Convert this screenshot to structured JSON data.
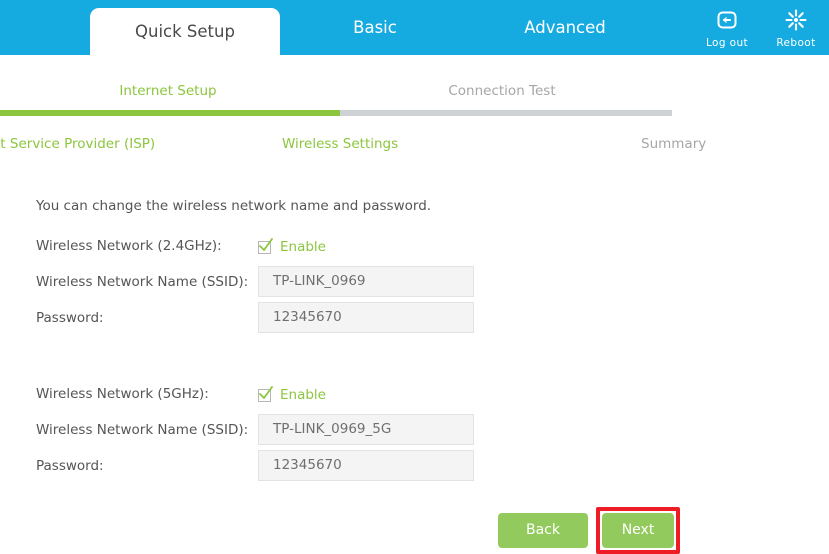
{
  "header": {
    "tabs": [
      {
        "label": "Quick Setup",
        "active": true
      },
      {
        "label": "Basic",
        "active": false
      },
      {
        "label": "Advanced",
        "active": false
      }
    ],
    "actions": [
      {
        "label": "Log out",
        "icon": "logout-icon"
      },
      {
        "label": "Reboot",
        "icon": "reboot-icon"
      }
    ]
  },
  "subtabs": [
    {
      "label": "Internet Setup",
      "state": "active"
    },
    {
      "label": "Connection Test",
      "state": "inactive"
    }
  ],
  "progress": {
    "percent": 50,
    "fill_color": "#8cc63e",
    "track_color": "#cfd2d4"
  },
  "steps": [
    {
      "label": "Internet Service Provider (ISP)",
      "state": "done"
    },
    {
      "label": "Wireless Settings",
      "state": "current"
    },
    {
      "label": "Summary",
      "state": "pending"
    }
  ],
  "main": {
    "intro": "You can change the wireless network name and password.",
    "sections": [
      {
        "enable_label": "Wireless Network (2.4GHz):",
        "enable_text": "Enable",
        "enable_checked": true,
        "ssid_label": "Wireless Network Name (SSID):",
        "ssid_value": "TP-LINK_0969",
        "password_label": "Password:",
        "password_value": "12345670"
      },
      {
        "enable_label": "Wireless Network (5GHz):",
        "enable_text": "Enable",
        "enable_checked": true,
        "ssid_label": "Wireless Network Name (SSID):",
        "ssid_value": "TP-LINK_0969_5G",
        "password_label": "Password:",
        "password_value": "12345670"
      }
    ]
  },
  "footer": {
    "back_label": "Back",
    "next_label": "Next",
    "highlight_color": "#ee1c25",
    "button_color": "#93ca5d"
  },
  "theme": {
    "header_blue": "#16abe0",
    "accent_green": "#8cc63e",
    "muted_gray": "#a6a6a6"
  }
}
